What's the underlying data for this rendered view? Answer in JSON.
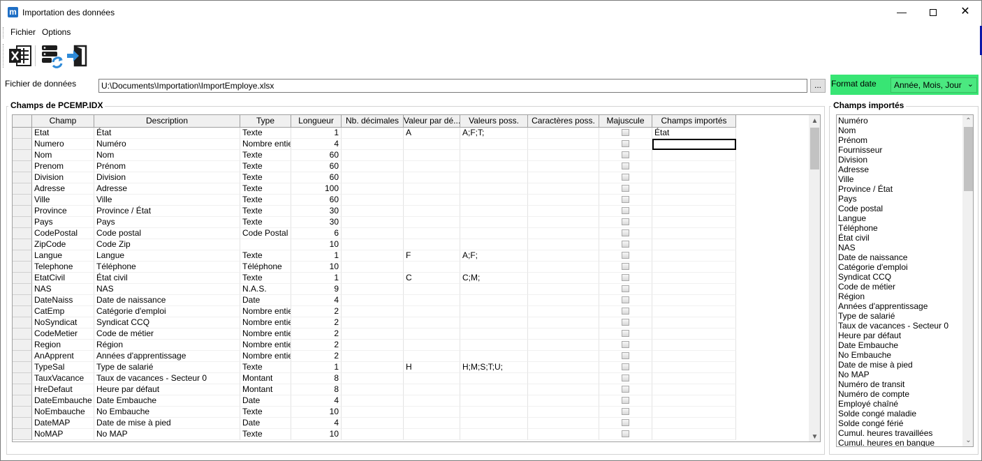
{
  "window": {
    "title": "Importation des données",
    "app_icon_letter": "m",
    "minimize_glyph": "—",
    "close_glyph": "✕"
  },
  "menu": [
    "Fichier",
    "Options"
  ],
  "toolbar": {
    "buttons": [
      "excel-icon",
      "database-refresh-icon",
      "import-exit-icon"
    ]
  },
  "file": {
    "label": "Fichier de données",
    "value": "U:\\Documents\\Importation\\ImportEmploye.xlsx",
    "browse_label": "..."
  },
  "date_format": {
    "label": "Format date",
    "value": "Année, Mois, Jour",
    "panel_color": "#38e574"
  },
  "grid": {
    "title": "Champs de PCEMP.IDX",
    "columns": [
      "Champ",
      "Description",
      "Type",
      "Longueur",
      "Nb. décimales",
      "Valeur par dé...",
      "Valeurs poss.",
      "Caractères poss.",
      "Majuscule",
      "Champs importés"
    ],
    "rows": [
      [
        "Etat",
        "État",
        "Texte",
        "1",
        "",
        "A",
        "A;F;T;",
        "",
        "",
        "État"
      ],
      [
        "Numero",
        "Numéro",
        "Nombre entier",
        "4",
        "",
        "",
        "",
        "",
        "",
        ""
      ],
      [
        "Nom",
        "Nom",
        "Texte",
        "60",
        "",
        "",
        "",
        "",
        "",
        ""
      ],
      [
        "Prenom",
        "Prénom",
        "Texte",
        "60",
        "",
        "",
        "",
        "",
        "",
        ""
      ],
      [
        "Division",
        "Division",
        "Texte",
        "60",
        "",
        "",
        "",
        "",
        "",
        ""
      ],
      [
        "Adresse",
        "Adresse",
        "Texte",
        "100",
        "",
        "",
        "",
        "",
        "",
        ""
      ],
      [
        "Ville",
        "Ville",
        "Texte",
        "60",
        "",
        "",
        "",
        "",
        "",
        ""
      ],
      [
        "Province",
        "Province / État",
        "Texte",
        "30",
        "",
        "",
        "",
        "",
        "",
        ""
      ],
      [
        "Pays",
        "Pays",
        "Texte",
        "30",
        "",
        "",
        "",
        "",
        "",
        ""
      ],
      [
        "CodePostal",
        "Code postal",
        "Code Postal",
        "6",
        "",
        "",
        "",
        "",
        "",
        ""
      ],
      [
        "ZipCode",
        "Code Zip",
        "",
        "10",
        "",
        "",
        "",
        "",
        "",
        ""
      ],
      [
        "Langue",
        "Langue",
        "Texte",
        "1",
        "",
        "F",
        "A;F;",
        "",
        "",
        ""
      ],
      [
        "Telephone",
        "Téléphone",
        "Téléphone",
        "10",
        "",
        "",
        "",
        "",
        "",
        ""
      ],
      [
        "EtatCivil",
        "État civil",
        "Texte",
        "1",
        "",
        "C",
        "C;M;",
        "",
        "",
        ""
      ],
      [
        "NAS",
        "NAS",
        "N.A.S.",
        "9",
        "",
        "",
        "",
        "",
        "",
        ""
      ],
      [
        "DateNaiss",
        "Date de naissance",
        "Date",
        "4",
        "",
        "",
        "",
        "",
        "",
        ""
      ],
      [
        "CatEmp",
        "Catégorie d'emploi",
        "Nombre entier",
        "2",
        "",
        "",
        "",
        "",
        "",
        ""
      ],
      [
        "NoSyndicat",
        "Syndicat CCQ",
        "Nombre entier",
        "2",
        "",
        "",
        "",
        "",
        "",
        ""
      ],
      [
        "CodeMetier",
        "Code de métier",
        "Nombre entier",
        "2",
        "",
        "",
        "",
        "",
        "",
        ""
      ],
      [
        "Region",
        "Région",
        "Nombre entier",
        "2",
        "",
        "",
        "",
        "",
        "",
        ""
      ],
      [
        "AnApprent",
        "Années d'apprentissage",
        "Nombre entier",
        "2",
        "",
        "",
        "",
        "",
        "",
        ""
      ],
      [
        "TypeSal",
        "Type de salarié",
        "Texte",
        "1",
        "",
        "H",
        "H;M;S;T;U;",
        "",
        "",
        ""
      ],
      [
        "TauxVacance",
        "Taux de vacances - Secteur 0",
        "Montant",
        "8",
        "",
        "",
        "",
        "",
        "",
        ""
      ],
      [
        "HreDefaut",
        "Heure par défaut",
        "Montant",
        "8",
        "",
        "",
        "",
        "",
        "",
        ""
      ],
      [
        "DateEmbauche",
        "Date Embauche",
        "Date",
        "4",
        "",
        "",
        "",
        "",
        "",
        ""
      ],
      [
        "NoEmbauche",
        "No Embauche",
        "Texte",
        "10",
        "",
        "",
        "",
        "",
        "",
        ""
      ],
      [
        "DateMAP",
        "Date de mise à pied",
        "Date",
        "4",
        "",
        "",
        "",
        "",
        "",
        ""
      ],
      [
        "NoMAP",
        "No MAP",
        "Texte",
        "10",
        "",
        "",
        "",
        "",
        "",
        ""
      ]
    ]
  },
  "imported": {
    "title": "Champs importés",
    "items": [
      "Numéro",
      "Nom",
      "Prénom",
      "Fournisseur",
      "Division",
      "Adresse",
      "Ville",
      "Province / État",
      "Pays",
      "Code postal",
      "Langue",
      "Téléphone",
      "État civil",
      "NAS",
      "Date de naissance",
      "Catégorie d'emploi",
      "Syndicat CCQ",
      "Code de métier",
      "Région",
      "Années d'apprentissage",
      "Type de salarié",
      "Taux de vacances - Secteur 0",
      "Heure par défaut",
      "Date Embauche",
      "No Embauche",
      "Date de mise à pied",
      "No MAP",
      "Numéro de transit",
      "Numéro de compte",
      "Employé chaîné",
      "Solde congé maladie",
      "Solde congé férié",
      "Cumul. heures travaillées",
      "Cumul. heures en banque"
    ]
  },
  "scroll_arrows": {
    "up": "▲",
    "down": "▼",
    "up_chevron": "⌃",
    "down_chevron": "⌄"
  }
}
